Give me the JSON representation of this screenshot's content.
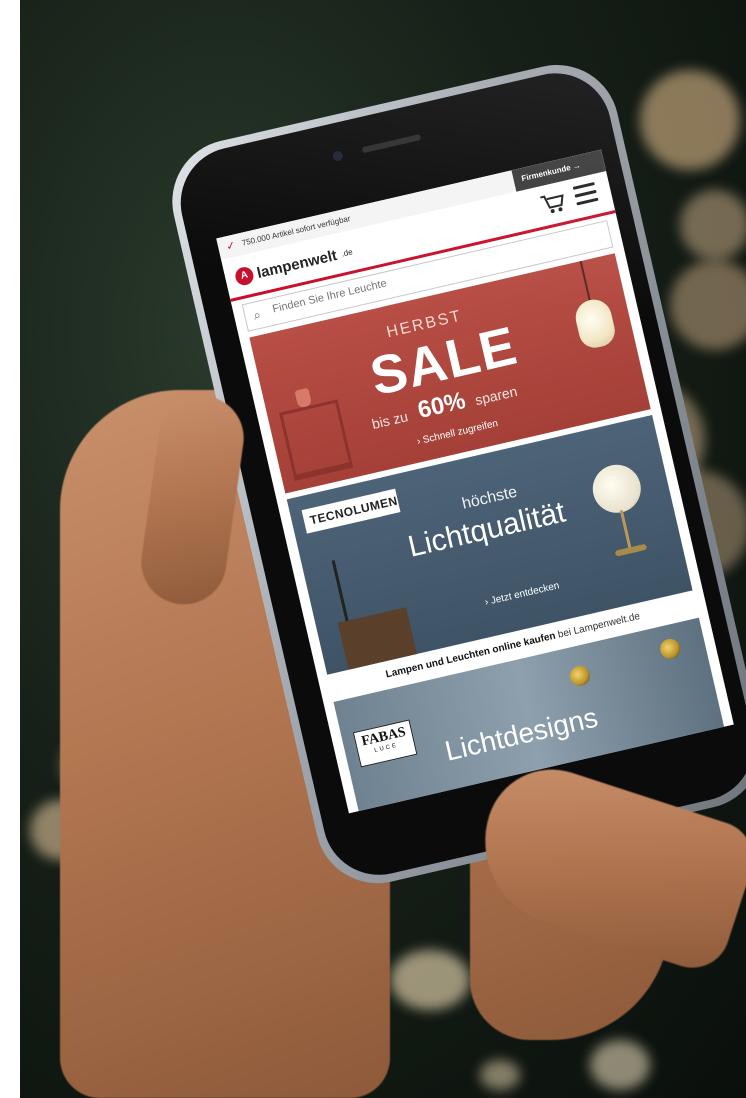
{
  "topbar": {
    "availability": "750.000 Artikel sofort verfügbar",
    "business_link": "Firmenkunde →"
  },
  "header": {
    "logo_name": "lampenwelt",
    "logo_tld": ".de"
  },
  "search": {
    "placeholder": "Finden Sie Ihre Leuchte"
  },
  "banner_sale": {
    "kicker": "HERBST",
    "headline": "SALE",
    "prefix": "bis zu",
    "percent": "60%",
    "suffix": "sparen",
    "cta": "› Schnell zugreifen"
  },
  "banner_tecnolumen": {
    "brand": "TECNOLUMEN",
    "line1": "höchste",
    "line2": "Lichtqualität",
    "cta": "› Jetzt entdecken"
  },
  "tagline": {
    "bold": "Lampen und Leuchten online kaufen",
    "rest": " bei Lampenwelt.de"
  },
  "banner_fabas": {
    "brand": "FABAS",
    "brand_sub": "LUCE",
    "title": "Lichtdesigns"
  },
  "colors": {
    "brand_red": "#c8102e",
    "sale_bg": "#a44037",
    "tecno_bg": "#4d6377"
  },
  "icons": [
    "check-icon",
    "cart-icon",
    "menu-icon",
    "search-icon",
    "logo-icon"
  ]
}
